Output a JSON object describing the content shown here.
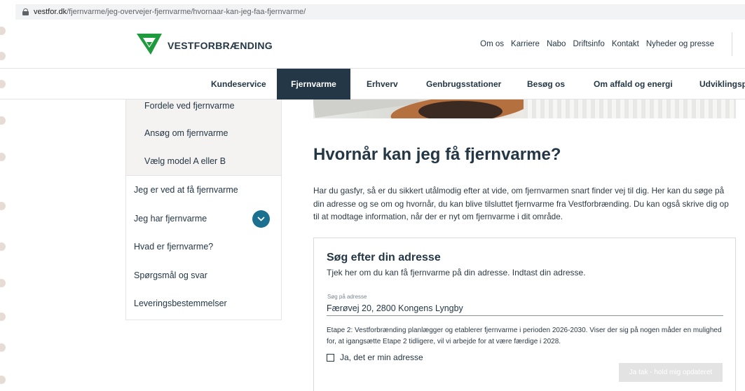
{
  "browser": {
    "url_domain": "vestfor.dk",
    "url_path": "/fjernvarme/jeg-overvejer-fjernvarme/hvornaar-kan-jeg-faa-fjernvarme/"
  },
  "brand": {
    "name": "VESTFORBRÆNDING",
    "color": "#1f9a3d"
  },
  "topnav": [
    "Om os",
    "Karriere",
    "Nabo",
    "Driftsinfo",
    "Kontakt",
    "Nyheder og presse"
  ],
  "mainnav": [
    "Kundeservice",
    "Fjernvarme",
    "Erhverv",
    "Genbrugsstationer",
    "Besøg os",
    "Om affald og energi",
    "Udviklingspr"
  ],
  "sidebar": {
    "subitems": [
      "Fordele ved fjernvarme",
      "Ansøg om fjernvarme",
      "Vælg model A eller B"
    ],
    "items": [
      "Jeg er ved at få fjernvarme",
      "Jeg har fjernvarme",
      "Hvad er fjernvarme?",
      "Spørgsmål og svar",
      "Leveringsbestemmelser"
    ]
  },
  "page": {
    "title": "Hvornår kan jeg få fjernvarme?",
    "intro": "Har du gasfyr, så er du sikkert utålmodig efter at vide, om fjernvarmen snart finder vej til dig. Her kan du søge på din adresse og se om og hvornår, du kan blive tilsluttet fjernvarme fra Vestforbrænding. Du kan også skrive dig op til at modtage information, når der er nyt om fjernvarme i dit område."
  },
  "search": {
    "title": "Søg efter din adresse",
    "subtitle": "Tjek her om du kan få fjernvarme på din adresse. Indtast din adresse.",
    "field_label": "Søg på adresse",
    "value": "Færøvej 20, 2800 Kongens Lyngby",
    "note": "Etape 2: Vestforbrænding planlægger og etablerer fjernvarme i perioden 2026-2030. Viser der sig på nogen måder en mulighed for, at igangsætte Etape 2 tidligere, vil vi arbejde for at være færdige i 2028.",
    "checkbox_label": "Ja, det er min adresse",
    "button_label": "Ja tak - hold mig opdateret"
  },
  "colors": {
    "navy": "#243746",
    "accent_teal": "#1b6f8f",
    "sidebar_bg": "#f5f3f1"
  }
}
